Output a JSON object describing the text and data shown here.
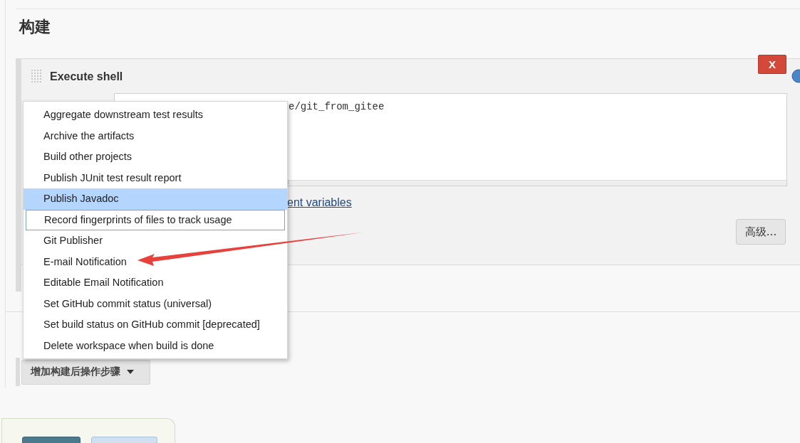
{
  "section_title": "构建",
  "build_step": {
    "title": "Execute shell",
    "delete_button": "X",
    "command": "e/git_from_gitee",
    "link": "ent variables",
    "advanced_button": "高级..."
  },
  "post_build_button": {
    "label": "增加构建后操作步骤"
  },
  "menu": {
    "items": [
      {
        "label": "Aggregate downstream test results",
        "selected": false,
        "focused": false
      },
      {
        "label": "Archive the artifacts",
        "selected": false,
        "focused": false
      },
      {
        "label": "Build other projects",
        "selected": false,
        "focused": false
      },
      {
        "label": "Publish JUnit test result report",
        "selected": false,
        "focused": false
      },
      {
        "label": "Publish Javadoc",
        "selected": true,
        "focused": false
      },
      {
        "label": "Record fingerprints of files to track usage",
        "selected": false,
        "focused": true
      },
      {
        "label": "Git Publisher",
        "selected": false,
        "focused": false
      },
      {
        "label": "E-mail Notification",
        "selected": false,
        "focused": false
      },
      {
        "label": "Editable Email Notification",
        "selected": false,
        "focused": false
      },
      {
        "label": "Set GitHub commit status (universal)",
        "selected": false,
        "focused": false
      },
      {
        "label": "Set build status on GitHub commit [deprecated]",
        "selected": false,
        "focused": false
      },
      {
        "label": "Delete workspace when build is done",
        "selected": false,
        "focused": false
      }
    ]
  },
  "annotation": {
    "kind": "arrow"
  }
}
